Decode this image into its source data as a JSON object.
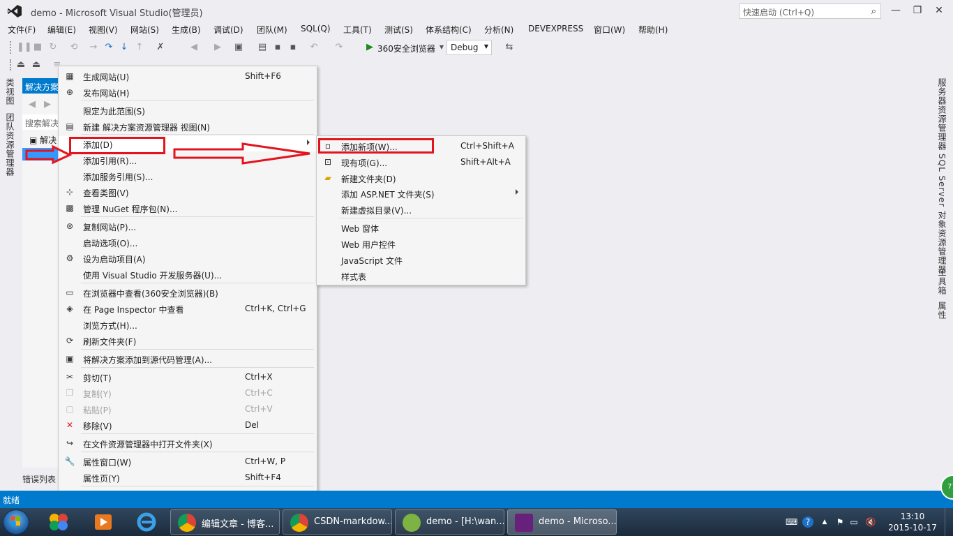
{
  "window": {
    "title": "demo - Microsoft Visual Studio(管理员)",
    "quick_launch_placeholder": "快速启动 (Ctrl+Q)",
    "minimize": "—",
    "restore": "❐",
    "close": "✕"
  },
  "menubar": [
    "文件(F)",
    "编辑(E)",
    "视图(V)",
    "网站(S)",
    "生成(B)",
    "调试(D)",
    "团队(M)",
    "SQL(Q)",
    "工具(T)",
    "测试(S)",
    "体系结构(C)",
    "分析(N)",
    "DEVEXPRESS",
    "窗口(W)",
    "帮助(H)"
  ],
  "toolbar": {
    "run_target": "360安全浏览器",
    "config": "Debug"
  },
  "left_tabs": [
    "类视图",
    "团队资源管理器"
  ],
  "right_tabs": [
    "服务器资源管理器",
    "SQL Server 对象资源管理器",
    "工具箱",
    "属性"
  ],
  "solution_explorer": {
    "title": "解决方案",
    "search": "搜索解决",
    "root": "解决"
  },
  "error_list": "错误列表",
  "status": "就绪",
  "badge": "71",
  "context_menu": [
    {
      "icon": "build-icon",
      "label": "生成网站(U)",
      "shortcut": "Shift+F6"
    },
    {
      "icon": "publish-icon",
      "label": "发布网站(H)",
      "shortcut": ""
    },
    {
      "icon": "",
      "label": "限定为此范围(S)",
      "shortcut": ""
    },
    {
      "icon": "new-view-icon",
      "label": "新建 解决方案资源管理器 视图(N)",
      "shortcut": ""
    },
    {
      "icon": "",
      "label": "添加(D)",
      "shortcut": "",
      "submenu": true
    },
    {
      "icon": "",
      "label": "添加引用(R)...",
      "shortcut": ""
    },
    {
      "icon": "",
      "label": "添加服务引用(S)...",
      "shortcut": ""
    },
    {
      "icon": "class-diagram-icon",
      "label": "查看类图(V)",
      "shortcut": ""
    },
    {
      "icon": "nuget-icon",
      "label": "管理 NuGet 程序包(N)...",
      "shortcut": ""
    },
    {
      "icon": "copy-site-icon",
      "label": "复制网站(P)...",
      "shortcut": ""
    },
    {
      "icon": "",
      "label": "启动选项(O)...",
      "shortcut": ""
    },
    {
      "icon": "gear-icon",
      "label": "设为启动项目(A)",
      "shortcut": ""
    },
    {
      "icon": "",
      "label": "使用 Visual Studio 开发服务器(U)...",
      "shortcut": ""
    },
    {
      "icon": "browser-icon",
      "label": "在浏览器中查看(360安全浏览器)(B)",
      "shortcut": ""
    },
    {
      "icon": "page-inspector-icon",
      "label": "在 Page Inspector 中查看",
      "shortcut": "Ctrl+K, Ctrl+G"
    },
    {
      "icon": "",
      "label": "浏览方式(H)...",
      "shortcut": ""
    },
    {
      "icon": "refresh-icon",
      "label": "刷新文件夹(F)",
      "shortcut": ""
    },
    {
      "icon": "source-control-icon",
      "label": "将解决方案添加到源代码管理(A)...",
      "shortcut": ""
    },
    {
      "icon": "cut-icon",
      "label": "剪切(T)",
      "shortcut": "Ctrl+X"
    },
    {
      "icon": "copy-icon",
      "label": "复制(Y)",
      "shortcut": "Ctrl+C",
      "disabled": true
    },
    {
      "icon": "paste-icon",
      "label": "粘贴(P)",
      "shortcut": "Ctrl+V",
      "disabled": true
    },
    {
      "icon": "remove-icon",
      "label": "移除(V)",
      "shortcut": "Del"
    },
    {
      "icon": "open-folder-icon",
      "label": "在文件资源管理器中打开文件夹(X)",
      "shortcut": ""
    },
    {
      "icon": "wrench-icon",
      "label": "属性窗口(W)",
      "shortcut": "Ctrl+W, P"
    },
    {
      "icon": "",
      "label": "属性页(Y)",
      "shortcut": "Shift+F4"
    },
    {
      "icon": "",
      "label": "对网站运行代码分析(L)",
      "shortcut": ""
    }
  ],
  "submenu": [
    {
      "icon": "new-item-icon",
      "label": "添加新项(W)...",
      "shortcut": "Ctrl+Shift+A"
    },
    {
      "icon": "existing-item-icon",
      "label": "现有项(G)...",
      "shortcut": "Shift+Alt+A"
    },
    {
      "icon": "new-folder-icon",
      "label": "新建文件夹(D)",
      "shortcut": ""
    },
    {
      "icon": "",
      "label": "添加 ASP.NET 文件夹(S)",
      "shortcut": "",
      "submenu": true
    },
    {
      "icon": "",
      "label": "新建虚拟目录(V)...",
      "shortcut": ""
    },
    {
      "icon": "",
      "label": "Web 窗体",
      "shortcut": ""
    },
    {
      "icon": "",
      "label": "Web 用户控件",
      "shortcut": ""
    },
    {
      "icon": "",
      "label": "JavaScript 文件",
      "shortcut": ""
    },
    {
      "icon": "",
      "label": "样式表",
      "shortcut": ""
    }
  ],
  "taskbar": {
    "tasks": [
      "编辑文章 - 博客...",
      "CSDN-markdow...",
      "demo - [H:\\wan...",
      "demo - Microso..."
    ],
    "time": "13:10",
    "date": "2015-10-17"
  },
  "colors": {
    "accent": "#007acc",
    "annotation": "#e3141e",
    "vs_purple": "#68217a"
  }
}
